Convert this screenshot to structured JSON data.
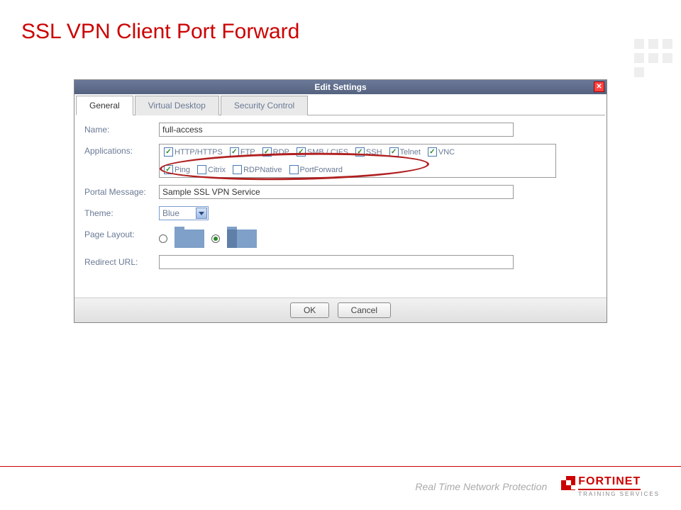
{
  "slide": {
    "title": "SSL VPN Client Port Forward"
  },
  "dialog": {
    "title": "Edit Settings",
    "tabs": [
      "General",
      "Virtual Desktop",
      "Security Control"
    ],
    "activeTab": 0,
    "fields": {
      "nameLabel": "Name:",
      "nameValue": "full-access",
      "appsLabel": "Applications:",
      "portalLabel": "Portal Message:",
      "portalValue": "Sample SSL VPN Service",
      "themeLabel": "Theme:",
      "themeValue": "Blue",
      "layoutLabel": "Page Layout:",
      "redirectLabel": "Redirect URL:",
      "redirectValue": ""
    },
    "apps": [
      {
        "label": "HTTP/HTTPS",
        "checked": true
      },
      {
        "label": "FTP",
        "checked": true
      },
      {
        "label": "RDP",
        "checked": true
      },
      {
        "label": "SMB / CIFS",
        "checked": true
      },
      {
        "label": "SSH",
        "checked": true
      },
      {
        "label": "Telnet",
        "checked": true
      },
      {
        "label": "VNC",
        "checked": true
      },
      {
        "label": "Ping",
        "checked": true
      },
      {
        "label": "Citrix",
        "checked": false
      },
      {
        "label": "RDPNative",
        "checked": false
      },
      {
        "label": "PortForward",
        "checked": false
      }
    ],
    "buttons": {
      "ok": "OK",
      "cancel": "Cancel"
    }
  },
  "footer": {
    "tagline": "Real Time Network Protection",
    "logo": "FORTINET",
    "logoSub": "TRAINING SERVICES"
  }
}
